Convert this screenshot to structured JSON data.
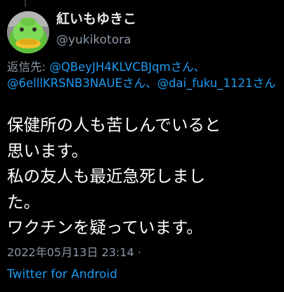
{
  "tweet": {
    "author": {
      "display_name": "紅いもゆきこ",
      "handle": "@yukikotora",
      "avatar_icon": "green-frog-hood-avatar"
    },
    "reply_to": {
      "prefix": "返信先: ",
      "mentions": [
        "@QBeyJH4KLVCBJqmさん、",
        "@6elllKRSNB3NAUEさん、",
        "@dai_fuku_1121さん"
      ]
    },
    "body_lines": [
      "保健所の人も苦しんでいると",
      "思います。",
      "私の友人も最近急死しまし",
      "た。",
      "ワクチンを疑っています。"
    ],
    "timestamp": "2022年05月13日 23:14 ·",
    "client": "Twitter for Android"
  },
  "colors": {
    "background": "#000000",
    "text_primary": "#ffffff",
    "text_secondary": "#8b98a5",
    "link": "#1d9bf0"
  }
}
